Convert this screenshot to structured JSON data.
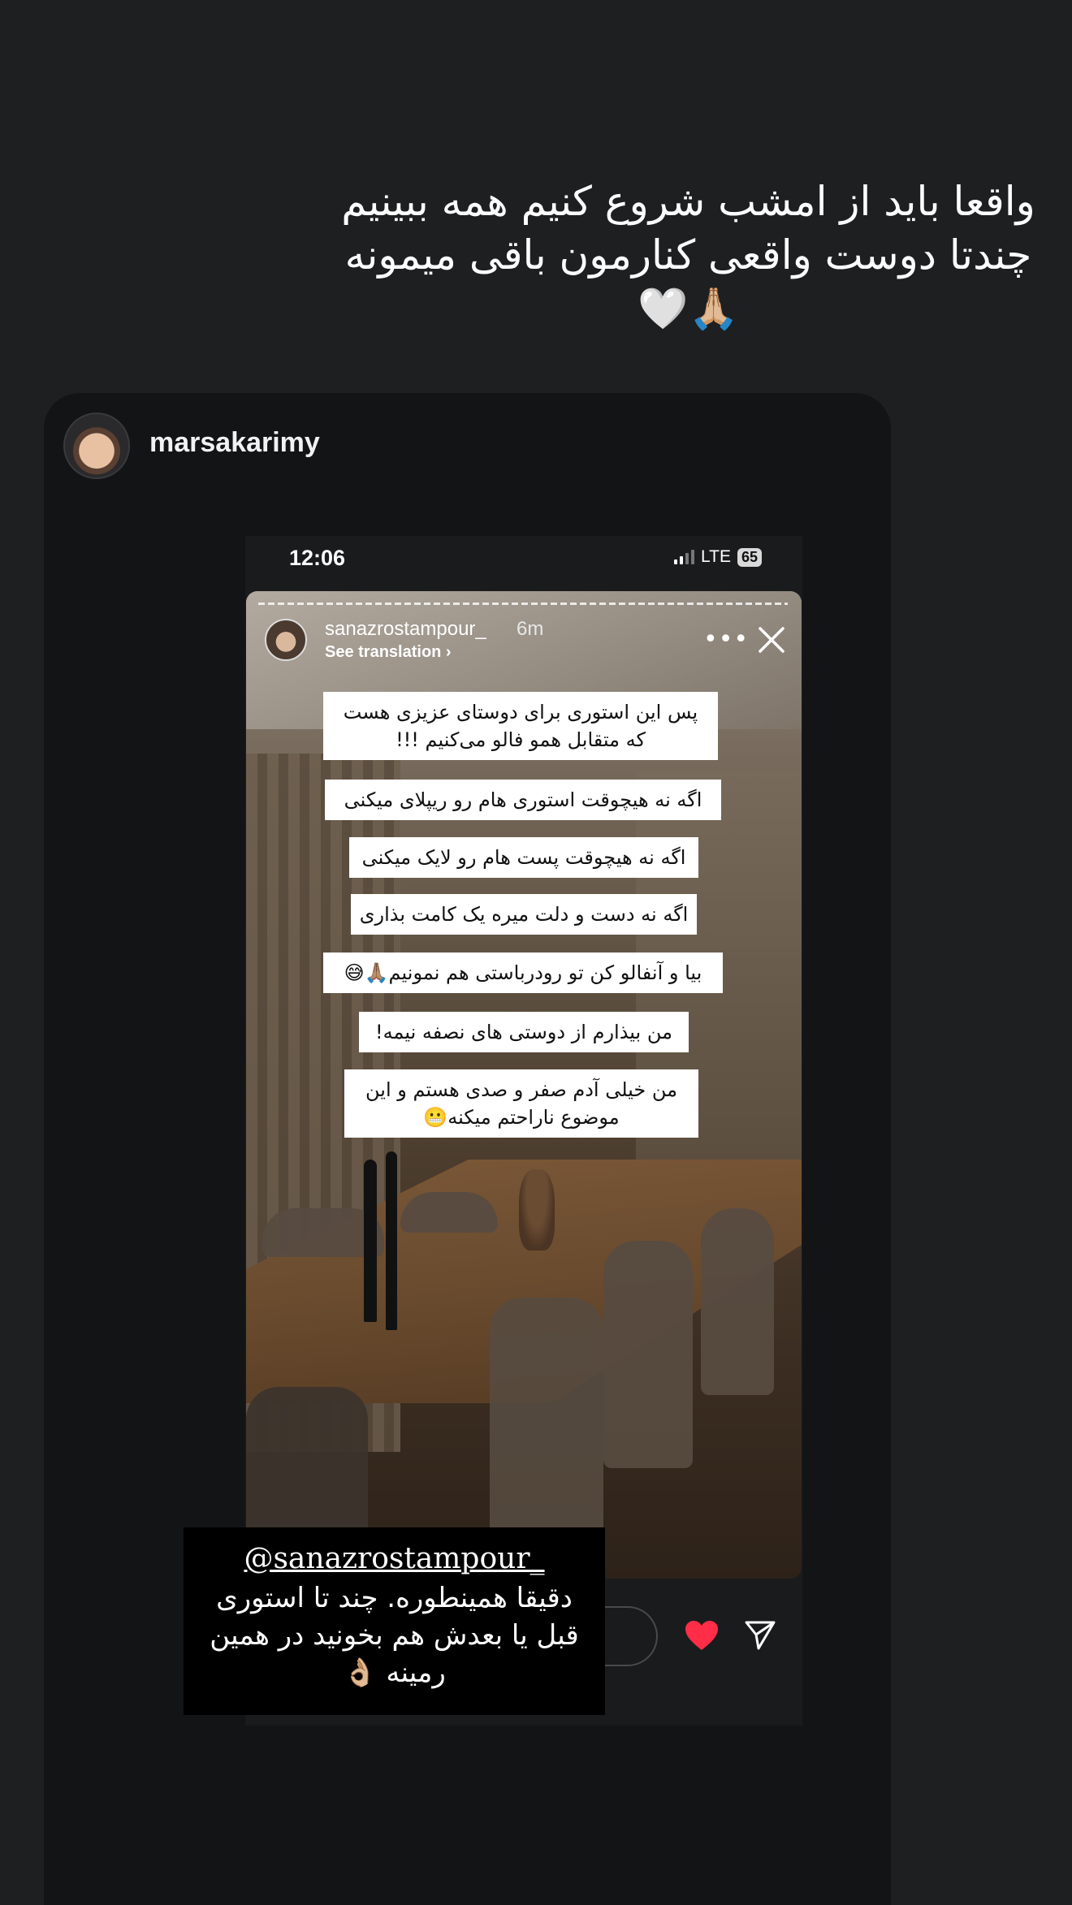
{
  "caption": {
    "text": "واقعا باید از امشب شروع کنیم همه ببینیم چندتا دوست واقعی کنارمون باقی میمونه🙏🏼🤍"
  },
  "shared_post": {
    "username": "marsakarimy"
  },
  "phone": {
    "time": "12:06",
    "network": "LTE",
    "battery": "65"
  },
  "story": {
    "username": "sanazrostampour_",
    "age": "6m",
    "see_translation": "See translation ›",
    "stickers": [
      "پس این استوری برای دوستای عزیزی هست که متقابل همو فالو می‌کنیم !!!",
      "اگه نه هیچوقت استوری هام رو ریپلای میکنی",
      "اگه نه هیچوقت پست هام رو لایک میکنی",
      "اگه نه دست و دلت میره یک کامت بذاری",
      "بیا و آنفالو کن تو رودرباستی هم نمونیم🙏🏽😅",
      "من بیذارم از دوستی های نصفه نیمه!",
      "من خیلی آدم صفر و صدی هستم و این موضوع ناراحتم میکنه😬"
    ]
  },
  "mention": {
    "handle": "@sanazrostampour_",
    "text": "دقیقا همینطوره. چند تا استوری قبل یا بعدش هم بخونید در همین رمینه 👌🏼"
  },
  "colors": {
    "background": "#1e1f21",
    "heart": "#ff2d48"
  },
  "icons": [
    "three-dots-icon",
    "close-icon",
    "heart-icon",
    "send-icon",
    "signal-icon",
    "battery-icon"
  ]
}
